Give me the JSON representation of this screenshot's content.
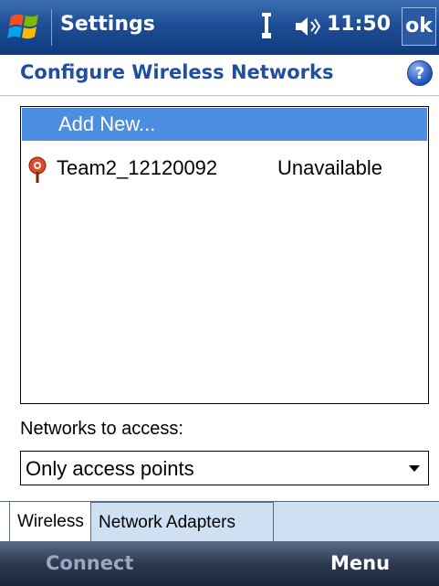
{
  "titlebar": {
    "app_title": "Settings",
    "time": "11:50",
    "ok_label": "ok",
    "icons": [
      "windows-start-icon",
      "signal-icon",
      "volume-icon"
    ]
  },
  "header": {
    "page_title": "Configure Wireless Networks",
    "help_label": "?"
  },
  "network_list": {
    "add_new_label": "Add New...",
    "networks": [
      {
        "name": "Team2_12120092",
        "status": "Unavailable",
        "icon": "access-point-icon"
      }
    ]
  },
  "access": {
    "label": "Networks to access:",
    "selected": "Only access points"
  },
  "tabs": [
    {
      "label": "Wireless",
      "active": true
    },
    {
      "label": "Network Adapters",
      "active": false
    }
  ],
  "softkeys": {
    "left": "Connect",
    "right": "Menu"
  },
  "colors": {
    "title_bar": "#1d4e96",
    "header_text": "#1f4fa0",
    "selection": "#4b8ee0",
    "tab_inactive": "#cfe0f2",
    "softkey_bar": "#2c3a52"
  }
}
